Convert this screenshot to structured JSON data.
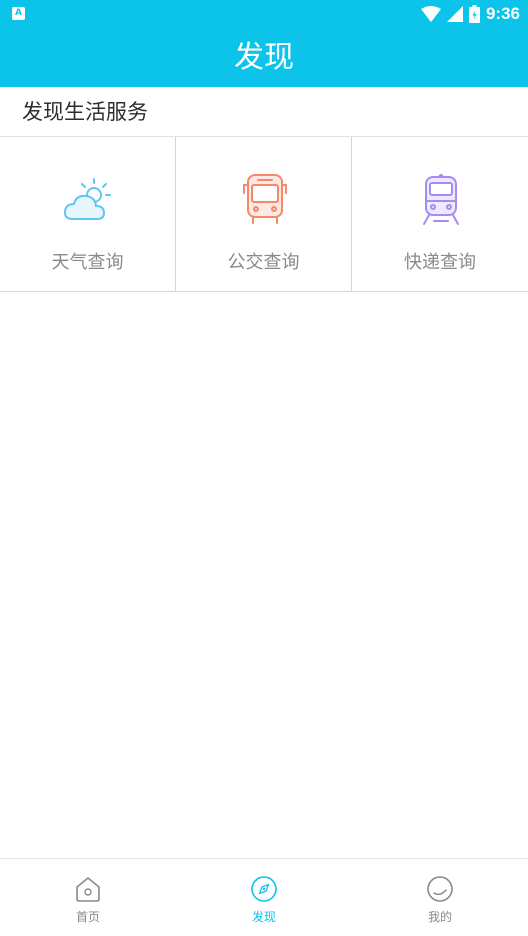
{
  "status_bar": {
    "notification_icon": "A",
    "time": "9:36",
    "icons": [
      "wifi-icon",
      "signal-icon",
      "battery-icon"
    ]
  },
  "header": {
    "title": "发现"
  },
  "section": {
    "title": "发现生活服务"
  },
  "services": [
    {
      "label": "天气查询",
      "icon": "weather-icon",
      "color": "#5ec8f2"
    },
    {
      "label": "公交查询",
      "icon": "bus-icon",
      "color": "#f5876a"
    },
    {
      "label": "快递查询",
      "icon": "train-icon",
      "color": "#a58cf0"
    }
  ],
  "bottom_nav": {
    "items": [
      {
        "label": "首页",
        "icon": "home-icon"
      },
      {
        "label": "发现",
        "icon": "discover-icon"
      },
      {
        "label": "我的",
        "icon": "profile-icon"
      }
    ],
    "active_index": 1
  },
  "colors": {
    "accent": "#0cc3ea",
    "inactive": "#8a8a8a"
  }
}
